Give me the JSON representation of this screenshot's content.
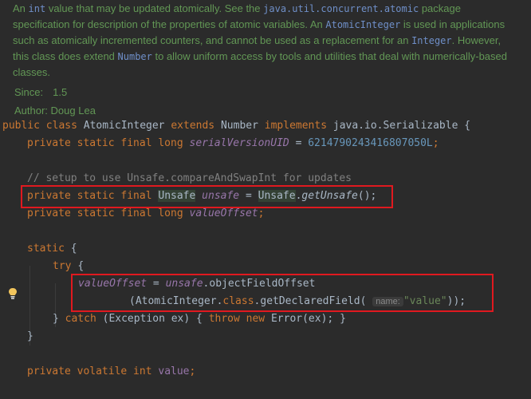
{
  "doc": {
    "p1": "An ",
    "p1_code": "int",
    "p2": " value that may be updated atomically. See the ",
    "p2_code": "java.util.concurrent.atomic",
    "p3": " package specification for description of the properties of atomic variables. An ",
    "p3_code": "AtomicInteger",
    "p4": " is used in applications such as atomically incremented counters, and cannot be used as a replacement for an ",
    "p4_code": "Integer",
    "p5": ". However, this class does extend ",
    "p5_code": "Number",
    "p6": " to allow uniform access by tools and utilities that deal with numerically-based classes.",
    "since_label": "Since:",
    "since_value": "1.5",
    "author_label": "Author:",
    "author_value": "Doug Lea"
  },
  "code": {
    "l1": {
      "public": "public",
      "class": "class",
      "name": "AtomicInteger",
      "extends": "extends",
      "number": "Number",
      "implements": "implements",
      "iface": "java.io.Serializable",
      "brace": "{"
    },
    "l2": {
      "mods": "private static final long",
      "field": "serialVersionUID",
      "eq": "=",
      "value": "6214790243416807050L",
      "semi": ";"
    },
    "l3": {
      "comment": "// setup to use Unsafe.compareAndSwapInt for updates"
    },
    "l4": {
      "mods": "private static final",
      "type": "Unsafe",
      "field": "unsafe",
      "eq": "=",
      "call_cls": "Unsafe",
      "dot": ".",
      "method": "getUnsafe",
      "tail": "();"
    },
    "l5": {
      "mods": "private static final long",
      "field": "valueOffset",
      "semi": ";"
    },
    "l6": {
      "kw": "static",
      "brace": "{"
    },
    "l7": {
      "kw": "try",
      "brace": "{"
    },
    "l8": {
      "field": "valueOffset",
      "eq": "=",
      "obj": "unsafe",
      "rest": ".objectFieldOffset"
    },
    "l9": {
      "pre": "(AtomicInteger.",
      "kw": "class",
      "mid": ".getDeclaredField(",
      "hint": "name:",
      "str": "\"value\"",
      "tail": "));"
    },
    "l10": {
      "close": "}",
      "catch": "catch",
      "mid": "(Exception ex) {",
      "throw": "throw",
      "new": "new",
      "rest": "Error(ex);",
      "close2": "}"
    },
    "l11": {
      "close": "}"
    },
    "l12": {
      "mods": "private volatile int",
      "field": "value",
      "semi": ";"
    }
  },
  "colors": {
    "highlight_box": "#e0191f",
    "keyword": "#cc7832",
    "field": "#9876aa",
    "number": "#6897bb",
    "string": "#6a8759",
    "comment": "#808080",
    "doc": "#629755"
  },
  "icons": {
    "intention": "lightbulb-icon"
  }
}
